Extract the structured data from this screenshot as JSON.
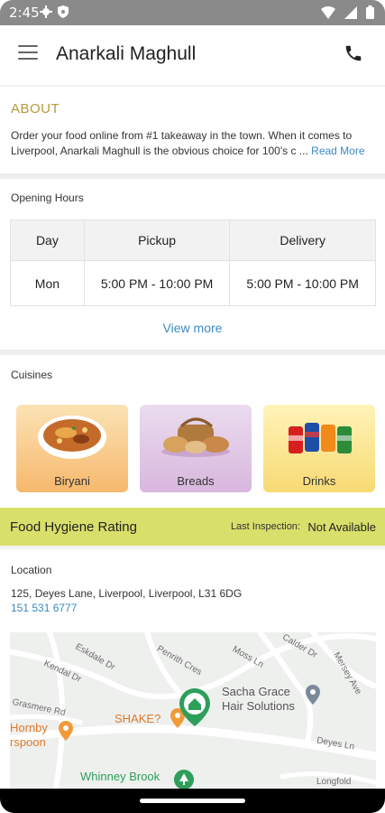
{
  "status_bar": {
    "time": "2:45"
  },
  "app_bar": {
    "title": "Anarkali Maghull"
  },
  "about": {
    "title": "ABOUT",
    "text": "Order your food online from #1 takeaway in the town. When it comes to Liverpool, Anarkali Maghull is the obvious choice for 100's c ...",
    "read_more": "Read More"
  },
  "opening_hours": {
    "label": "Opening Hours",
    "headers": [
      "Day",
      "Pickup",
      "Delivery"
    ],
    "rows": [
      {
        "day": "Mon",
        "pickup": "5:00 PM - 10:00 PM",
        "delivery": "5:00 PM - 10:00 PM"
      }
    ],
    "view_more": "View more"
  },
  "cuisines": {
    "label": "Cuisines",
    "items": [
      {
        "label": "Biryani"
      },
      {
        "label": "Breads"
      },
      {
        "label": "Drinks"
      }
    ]
  },
  "hygiene": {
    "title": "Food Hygiene Rating",
    "inspection_label": "Last Inspection:",
    "inspection_value": "Not Available"
  },
  "location": {
    "label": "Location",
    "address": "125, Deyes Lane, Liverpool, Liverpool, L31 6DG",
    "phone": "151 531 6777"
  },
  "map": {
    "streets": [
      "Eskdale Dr",
      "Kendal Dr",
      "Penrith Cres",
      "Moss Ln",
      "Calder Dr",
      "Mersey Ave",
      "Grasmere Rd",
      "Deyes Ln",
      "Longfold"
    ],
    "places": [
      "Sacha Grace",
      "Hair Solutions",
      "SHAKE?",
      "Hornby",
      "rspoon",
      "Whinney Brook"
    ]
  },
  "colors": {
    "accent_gold": "#b59a3a",
    "link_blue": "#3b8ac4",
    "hygiene_bar": "#d9df6b",
    "map_pin_green": "#2e9e5b"
  }
}
